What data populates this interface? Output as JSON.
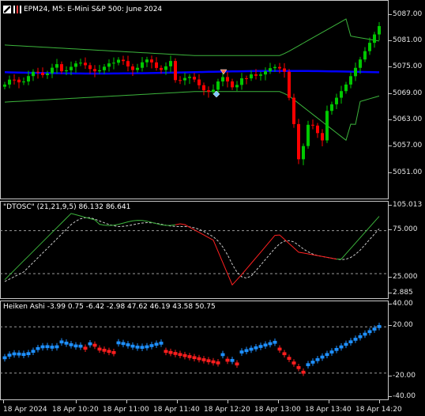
{
  "main_chart": {
    "title": "EPM24, M5:  E-Mini S&P 500: June 2024",
    "icons": [
      "chart-type-icon",
      "bars-icon"
    ],
    "price_axis": [
      "5087.00",
      "5081.00",
      "5075.00",
      "5069.00",
      "5063.00",
      "5057.00",
      "5051.00"
    ],
    "colors": {
      "bull": "#00c800",
      "bear": "#ff0000",
      "band": "#3cb43c",
      "mid_line": "#0000ff",
      "arrow_down": "#ff6a4a",
      "arrow_up": "#7ec8ff"
    }
  },
  "oscillator": {
    "label": "\"DTOSC\" (21,21,9,5) 86.132 86.641",
    "axis": [
      "105.013",
      "75.000",
      "25.000",
      "2.885"
    ],
    "colors": {
      "fast": "#3cb43c",
      "slow": "#c8c8c8",
      "bear": "#ff2020"
    }
  },
  "heiken": {
    "label": "Heiken Ashi -3.99 0.75 -6.42 -2.98 47.62 46.19 43.58 50.75",
    "axis": [
      "40.00",
      "20.00",
      "-20.00",
      "-40.00"
    ],
    "colors": {
      "up": "#1e90ff",
      "down": "#ff1e1e"
    }
  },
  "time_axis": [
    "18 Apr 2024",
    "18 Apr 10:20",
    "18 Apr 11:00",
    "18 Apr 11:40",
    "18 Apr 12:20",
    "18 Apr 13:00",
    "18 Apr 13:40",
    "18 Apr 14:20"
  ]
}
